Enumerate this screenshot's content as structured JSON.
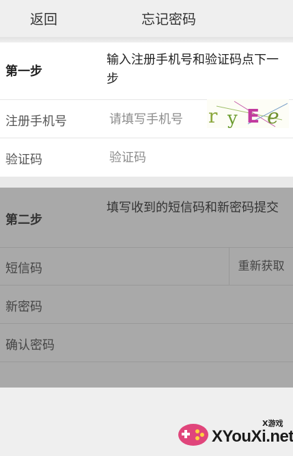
{
  "header": {
    "back_label": "返回",
    "title": "忘记密码"
  },
  "step1": {
    "label": "第一步",
    "description": "输入注册手机号和验证码点下一步",
    "phone": {
      "label": "注册手机号",
      "placeholder": "请填写手机号",
      "value": ""
    },
    "captcha_field": {
      "label": "验证码",
      "placeholder": "验证码",
      "value": ""
    },
    "captcha_image_text": "ryEe"
  },
  "step2": {
    "label": "第二步",
    "description": "填写收到的短信码和新密码提交",
    "sms_code": {
      "label": "短信码",
      "value": ""
    },
    "resend_label": "重新获取",
    "new_password": {
      "label": "新密码",
      "value": ""
    },
    "confirm_password": {
      "label": "确认密码",
      "value": ""
    }
  },
  "watermark": {
    "small_text": "X游戏",
    "main_text": "XYouXi.net"
  },
  "colors": {
    "page_bg": "#efefef",
    "panel_bg": "#ffffff",
    "disabled_panel_bg": "#a9a9a9",
    "captcha_green": "#7c9a2b",
    "captcha_magenta": "#c23a9e",
    "watermark_pink": "#e0457b"
  }
}
